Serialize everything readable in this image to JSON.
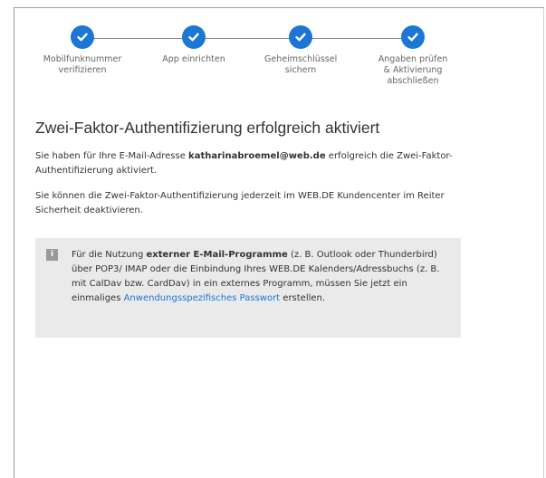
{
  "steps": [
    {
      "label": "Mobilfunknummer verifizieren",
      "icon": "check-icon"
    },
    {
      "label": "App einrichten",
      "icon": "check-icon"
    },
    {
      "label": "Geheimschlüssel sichern",
      "icon": "check-icon"
    },
    {
      "label": "Angaben prüfen & Aktivierung abschließen",
      "icon": "check-icon"
    }
  ],
  "title": "Zwei-Faktor-Authentifizierung erfolgreich aktiviert",
  "para1": {
    "before": "Sie haben für Ihre E-Mail-Adresse ",
    "email": "katharinabroemel@web.de",
    "after": " erfolgreich die Zwei-Faktor-Authentifizierung aktiviert."
  },
  "para2": "Sie können die Zwei-Faktor-Authentifizierung jederzeit im WEB.DE Kundencenter im Reiter Sicherheit deaktivieren.",
  "info": {
    "icon": "info-icon",
    "icon_glyph": "i",
    "text1": "Für die Nutzung ",
    "bold": "externer E-Mail-Programme",
    "text2": " (z. B. Outlook oder Thunderbird) über POP3/ IMAP oder die Einbindung Ihres WEB.DE Kalenders/Adressbuchs (z. B. mit CalDav bzw. CardDav) in ein externes Programm, müssen Sie jetzt ein einmaliges ",
    "link": "Anwendungsspezifisches Passwort",
    "text3": " erstellen."
  },
  "colors": {
    "accent": "#1c76d4",
    "info_bg": "#eaeaea"
  }
}
